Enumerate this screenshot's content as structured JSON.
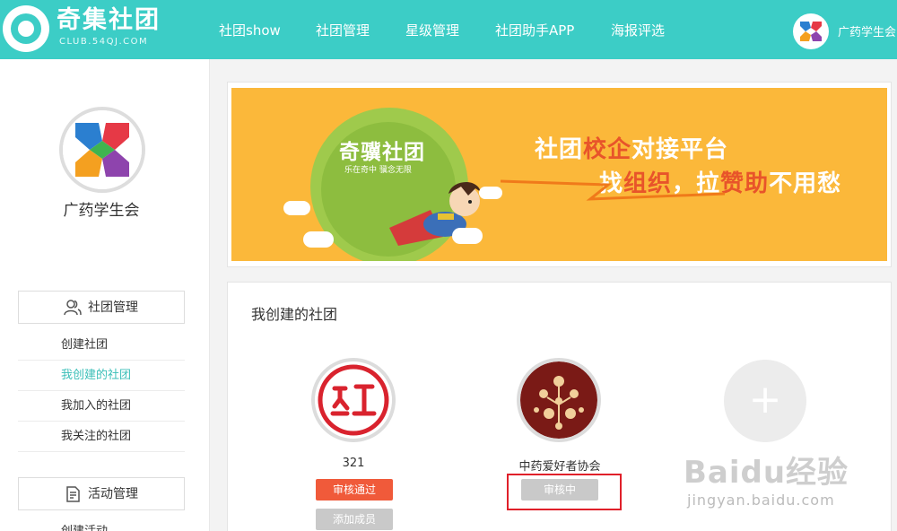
{
  "header": {
    "logo_title": "奇集社团",
    "logo_subtitle": "CLUB.54QJ.COM",
    "nav": [
      "社团show",
      "社团管理",
      "星级管理",
      "社团助手APP",
      "海报评选"
    ],
    "user_name": "广药学生会"
  },
  "sidebar": {
    "org_name": "广药学生会",
    "section1_label": "社团管理",
    "section1_items": [
      "创建社团",
      "我创建的社团",
      "我加入的社团",
      "我关注的社团"
    ],
    "section2_label": "活动管理",
    "section2_items": [
      "创建活动"
    ]
  },
  "banner": {
    "brand": "奇骥社团",
    "slogan": "乐在奇中 骥念无限",
    "line1_a": "社团",
    "line1_b": "校企",
    "line1_c": "对接平台",
    "line2_a": "找",
    "line2_b": "组织",
    "line2_c": "，拉",
    "line2_d": "赞助",
    "line2_e": "不用愁"
  },
  "my_clubs": {
    "title": "我创建的社团",
    "clubs": [
      {
        "name": "321",
        "status": "审核通过",
        "action": "添加成员"
      },
      {
        "name": "中药爱好者协会",
        "status": "审核中"
      }
    ],
    "add_symbol": "+"
  },
  "watermark": {
    "main": "Baidu经验",
    "sub": "jingyan.baidu.com"
  },
  "colors": {
    "brand_teal": "#3ccdc6",
    "active_link": "#3bbfb8",
    "approved_red": "#f05a3a",
    "pending_gray": "#c9c9c9",
    "highlight_red": "#e0202a",
    "banner_orange": "#fbb83a"
  },
  "icons": [
    "logo-icon",
    "user-group-icon",
    "document-icon",
    "plus-icon"
  ]
}
